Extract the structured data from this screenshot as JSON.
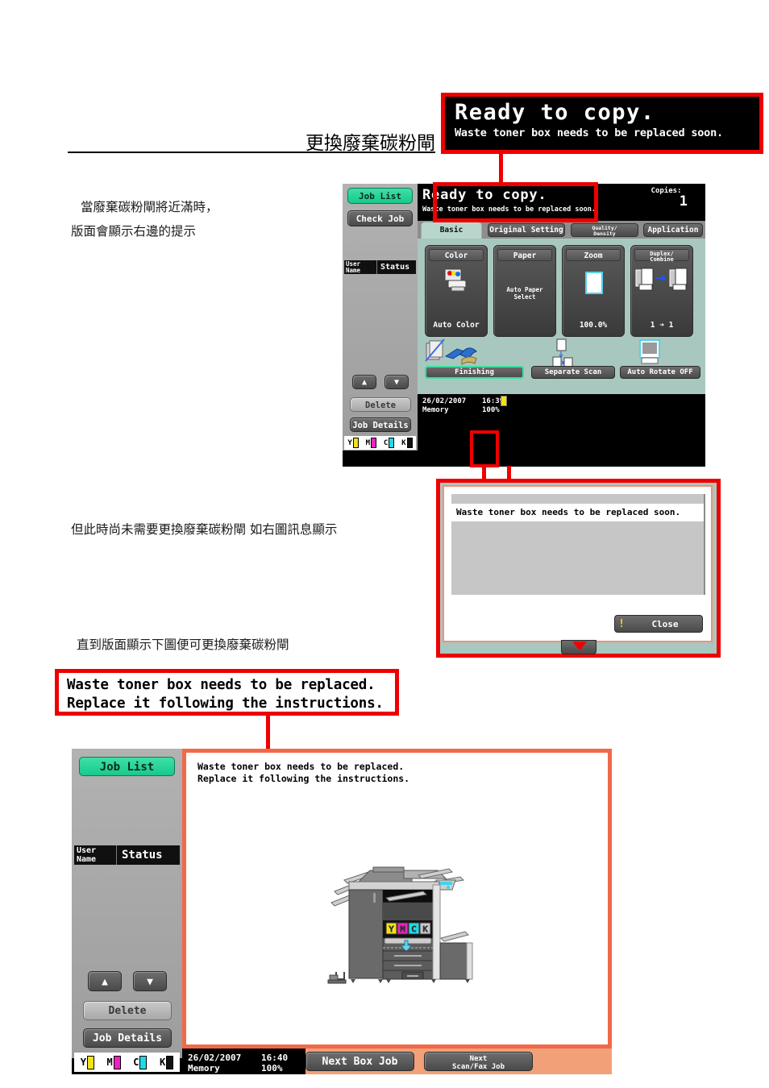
{
  "document": {
    "title": "更換廢棄碳粉閘",
    "notes": {
      "line1a": "當廢棄碳粉閘將近滿時，",
      "line1b": "版面會顯示右邊的提示",
      "line2": "但此時尚未需要更換廢棄碳粉閘 如右圖訊息顯示",
      "line3": "直到版面顯示下圖便可更換廢棄碳粉閘"
    }
  },
  "colors": {
    "callout_border": "#ee0000",
    "panel_teal": "#a8c7bf",
    "job_list_green": "#18c98b",
    "alert_orange": "#f2a077",
    "alert_border": "#f06a4a",
    "toner_y": "#f2e216",
    "toner_m": "#ee22c0",
    "toner_c": "#22d8e8",
    "toner_k": "#111111"
  },
  "callout_top": {
    "line1": "Ready to copy.",
    "line2": "Waste toner box needs to be replaced soon."
  },
  "callout_bottom": {
    "line1": "Waste toner box needs to be replaced.",
    "line2": "Replace it following the instructions."
  },
  "panel_basic": {
    "sidebar": {
      "job_list": "Job List",
      "check_job": "Check Job",
      "user_name_header": "User\nName",
      "user_name_header_l1": "User",
      "user_name_header_l2": "Name",
      "status_header": "Status",
      "up_arrow": "▲",
      "down_arrow": "▼",
      "delete": "Delete",
      "job_details": "Job Details",
      "toner": [
        {
          "label": "Y",
          "color": "#f2e216",
          "level": 100
        },
        {
          "label": "M",
          "color": "#ee22c0",
          "level": 100
        },
        {
          "label": "C",
          "color": "#22d8e8",
          "level": 100
        },
        {
          "label": "K",
          "color": "#111111",
          "level": 100
        }
      ]
    },
    "message": {
      "primary": "Ready to copy.",
      "secondary": "Waste toner box needs to be replaced soon."
    },
    "copies": {
      "label": "Copies:",
      "value": "1"
    },
    "tabs": [
      {
        "label": "Basic",
        "active": true
      },
      {
        "label": "Original Setting",
        "active": false
      },
      {
        "label": "Quality/",
        "label2": "Density",
        "active": false
      },
      {
        "label": "Application",
        "active": false
      }
    ],
    "function_buttons": [
      {
        "caption": "Color",
        "value": "Auto Color",
        "icon": "color-printer-icon"
      },
      {
        "caption": "Paper",
        "value_l1": "Auto Paper",
        "value_l2": "Select",
        "icon": "paper-icon"
      },
      {
        "caption": "Zoom",
        "value": "100.0%",
        "icon": "page-icon"
      },
      {
        "caption_l1": "Duplex/",
        "caption_l2": "Combine",
        "value": "1 ➜ 1",
        "icon": "duplex-icon"
      }
    ],
    "small_buttons": [
      {
        "label": "Finishing",
        "selected": true,
        "icon": "stapler-icon"
      },
      {
        "label": "Separate Scan",
        "selected": false,
        "icon": "separate-scan-icon"
      },
      {
        "label": "Auto Rotate OFF",
        "selected": false,
        "icon": "rotate-icon"
      }
    ],
    "status_bar": {
      "date": "26/02/2007",
      "time": "16:39",
      "memory_label": "Memory",
      "memory_value": "100%"
    }
  },
  "dialog": {
    "message": "Waste toner box needs to be replaced soon.",
    "close_button": "Close",
    "warning_icon": "!"
  },
  "panel_alert": {
    "sidebar": {
      "job_list": "Job List",
      "user_name_header_l1": "User",
      "user_name_header_l2": "Name",
      "status_header": "Status",
      "up_arrow": "▲",
      "down_arrow": "▼",
      "delete": "Delete",
      "job_details": "Job Details",
      "toner": [
        {
          "label": "Y",
          "color": "#f2e216"
        },
        {
          "label": "M",
          "color": "#ee22c0"
        },
        {
          "label": "C",
          "color": "#22d8e8"
        },
        {
          "label": "K",
          "color": "#111111"
        }
      ]
    },
    "message_l1": "Waste toner box needs to be replaced.",
    "message_l2": "Replace it following the instructions.",
    "illustration": "copier-waste-toner-box-diagram",
    "status_bar": {
      "date": "26/02/2007",
      "time": "16:40",
      "memory_label": "Memory",
      "memory_value": "100%"
    },
    "buttons": [
      {
        "label": "Next Box Job"
      },
      {
        "label_l1": "Next",
        "label_l2": "Scan/Fax Job"
      }
    ]
  }
}
